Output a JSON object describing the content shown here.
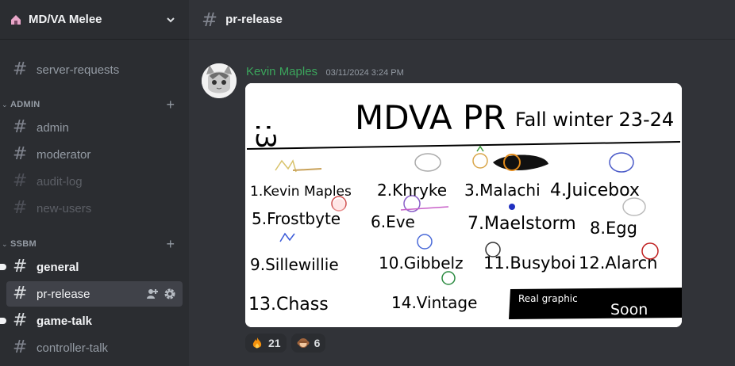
{
  "guild": {
    "name": "MD/VA Melee",
    "icon": "house-icon"
  },
  "sidebar": {
    "channels_top": [
      {
        "name": "server-requests"
      }
    ],
    "categories": [
      {
        "name": "ADMIN",
        "channels": [
          {
            "name": "admin"
          },
          {
            "name": "moderator"
          },
          {
            "name": "audit-log"
          },
          {
            "name": "new-users"
          }
        ]
      },
      {
        "name": "SSBM",
        "channels": [
          {
            "name": "general"
          },
          {
            "name": "pr-release"
          },
          {
            "name": "game-talk"
          },
          {
            "name": "controller-talk"
          }
        ]
      }
    ]
  },
  "header": {
    "channel": "pr-release"
  },
  "message": {
    "author": "Kevin Maples",
    "timestamp": "03/11/2024 3:24 PM",
    "author_color": "#3ba55c",
    "image": {
      "title_face": ":3",
      "title": "MDVA PR",
      "subtitle": "Fall winter 23-24",
      "rankings": [
        "1.Kevin Maples",
        "2.Khryke",
        "3.Malachi",
        "4.Juicebox",
        "5.Frostbyte",
        "6.Eve",
        "7.Maelstorm",
        "8.Egg",
        "9.Sillewillie",
        "10.Gibbelz",
        "11.Busyboi",
        "12.Alarcn",
        "13.Chass",
        "14.Vintage"
      ],
      "banner_line1": "Real graphic",
      "banner_line2": "Soon"
    }
  },
  "reactions": [
    {
      "emoji": "fire-icon",
      "count": "21"
    },
    {
      "emoji": "monkey-icon",
      "count": "6"
    }
  ]
}
